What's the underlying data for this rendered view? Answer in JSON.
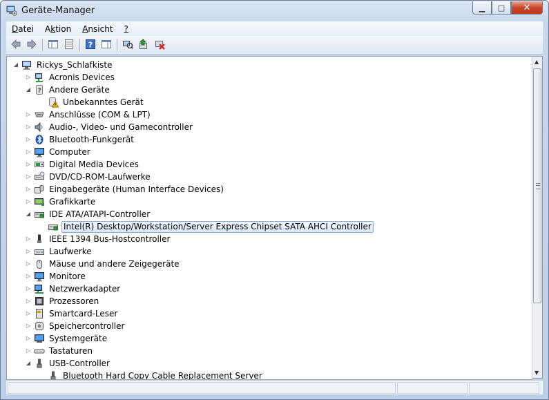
{
  "window": {
    "title": "Geräte-Manager"
  },
  "menu": [
    {
      "label": "Datei",
      "accel": "D"
    },
    {
      "label": "Aktion",
      "accel": "k"
    },
    {
      "label": "Ansicht",
      "accel": "A"
    },
    {
      "label": "?",
      "accel": "?"
    }
  ],
  "toolbar": [
    {
      "name": "back",
      "icon": "arrow-left-icon"
    },
    {
      "name": "forward",
      "icon": "arrow-right-icon"
    },
    {
      "name": "show-hide-tree",
      "icon": "console-tree-icon"
    },
    {
      "name": "properties",
      "icon": "properties-icon"
    },
    {
      "name": "help",
      "icon": "help-icon"
    },
    {
      "name": "action-pane",
      "icon": "action-pane-icon"
    },
    {
      "name": "scan-hardware",
      "icon": "scan-hardware-icon"
    },
    {
      "name": "update-driver",
      "icon": "update-driver-icon"
    },
    {
      "name": "uninstall",
      "icon": "uninstall-icon"
    }
  ],
  "tree": {
    "root": "Rickys_Schlafkiste",
    "items": [
      {
        "label": "Acronis Devices",
        "level": 1,
        "expander": "collapsed",
        "icon": "network-device-icon"
      },
      {
        "label": "Andere Geräte",
        "level": 1,
        "expander": "expanded",
        "icon": "unknown-device-icon"
      },
      {
        "label": "Unbekanntes Gerät",
        "level": 2,
        "expander": "none",
        "icon": "warning-device-icon"
      },
      {
        "label": "Anschlüsse (COM & LPT)",
        "level": 1,
        "expander": "collapsed",
        "icon": "port-icon"
      },
      {
        "label": "Audio-, Video- und Gamecontroller",
        "level": 1,
        "expander": "collapsed",
        "icon": "speaker-icon"
      },
      {
        "label": "Bluetooth-Funkgerät",
        "level": 1,
        "expander": "collapsed",
        "icon": "bluetooth-icon"
      },
      {
        "label": "Computer",
        "level": 1,
        "expander": "collapsed",
        "icon": "monitor-icon"
      },
      {
        "label": "Digital Media Devices",
        "level": 1,
        "expander": "collapsed",
        "icon": "media-device-icon"
      },
      {
        "label": "DVD/CD-ROM-Laufwerke",
        "level": 1,
        "expander": "collapsed",
        "icon": "dvd-drive-icon"
      },
      {
        "label": "Eingabegeräte (Human Interface Devices)",
        "level": 1,
        "expander": "collapsed",
        "icon": "hid-icon"
      },
      {
        "label": "Grafikkarte",
        "level": 1,
        "expander": "collapsed",
        "icon": "display-adapter-icon"
      },
      {
        "label": "IDE ATA/ATAPI-Controller",
        "level": 1,
        "expander": "expanded",
        "icon": "ide-controller-icon"
      },
      {
        "label": "Intel(R) Desktop/Workstation/Server Express Chipset SATA AHCI Controller",
        "level": 2,
        "expander": "none",
        "icon": "ide-controller-icon",
        "selected": true
      },
      {
        "label": "IEEE 1394 Bus-Hostcontroller",
        "level": 1,
        "expander": "collapsed",
        "icon": "firewire-icon"
      },
      {
        "label": "Laufwerke",
        "level": 1,
        "expander": "collapsed",
        "icon": "disk-drive-icon"
      },
      {
        "label": "Mäuse und andere Zeigegeräte",
        "level": 1,
        "expander": "collapsed",
        "icon": "mouse-icon"
      },
      {
        "label": "Monitore",
        "level": 1,
        "expander": "collapsed",
        "icon": "monitor-icon"
      },
      {
        "label": "Netzwerkadapter",
        "level": 1,
        "expander": "collapsed",
        "icon": "network-adapter-icon"
      },
      {
        "label": "Prozessoren",
        "level": 1,
        "expander": "collapsed",
        "icon": "processor-icon"
      },
      {
        "label": "Smartcard-Leser",
        "level": 1,
        "expander": "collapsed",
        "icon": "smartcard-icon"
      },
      {
        "label": "Speichercontroller",
        "level": 1,
        "expander": "collapsed",
        "icon": "storage-controller-icon"
      },
      {
        "label": "Systemgeräte",
        "level": 1,
        "expander": "collapsed",
        "icon": "system-device-icon"
      },
      {
        "label": "Tastaturen",
        "level": 1,
        "expander": "collapsed",
        "icon": "keyboard-icon"
      },
      {
        "label": "USB-Controller",
        "level": 1,
        "expander": "expanded",
        "icon": "usb-icon"
      },
      {
        "label": "Bluetooth Hard Copy Cable Replacement Server",
        "level": 2,
        "expander": "none",
        "icon": "usb-icon"
      }
    ]
  },
  "colors": {
    "selection_border": "#84acdd",
    "selection_fill": "#dbe9fa",
    "close_button": "#c9462c",
    "warning": "#f2c200"
  }
}
